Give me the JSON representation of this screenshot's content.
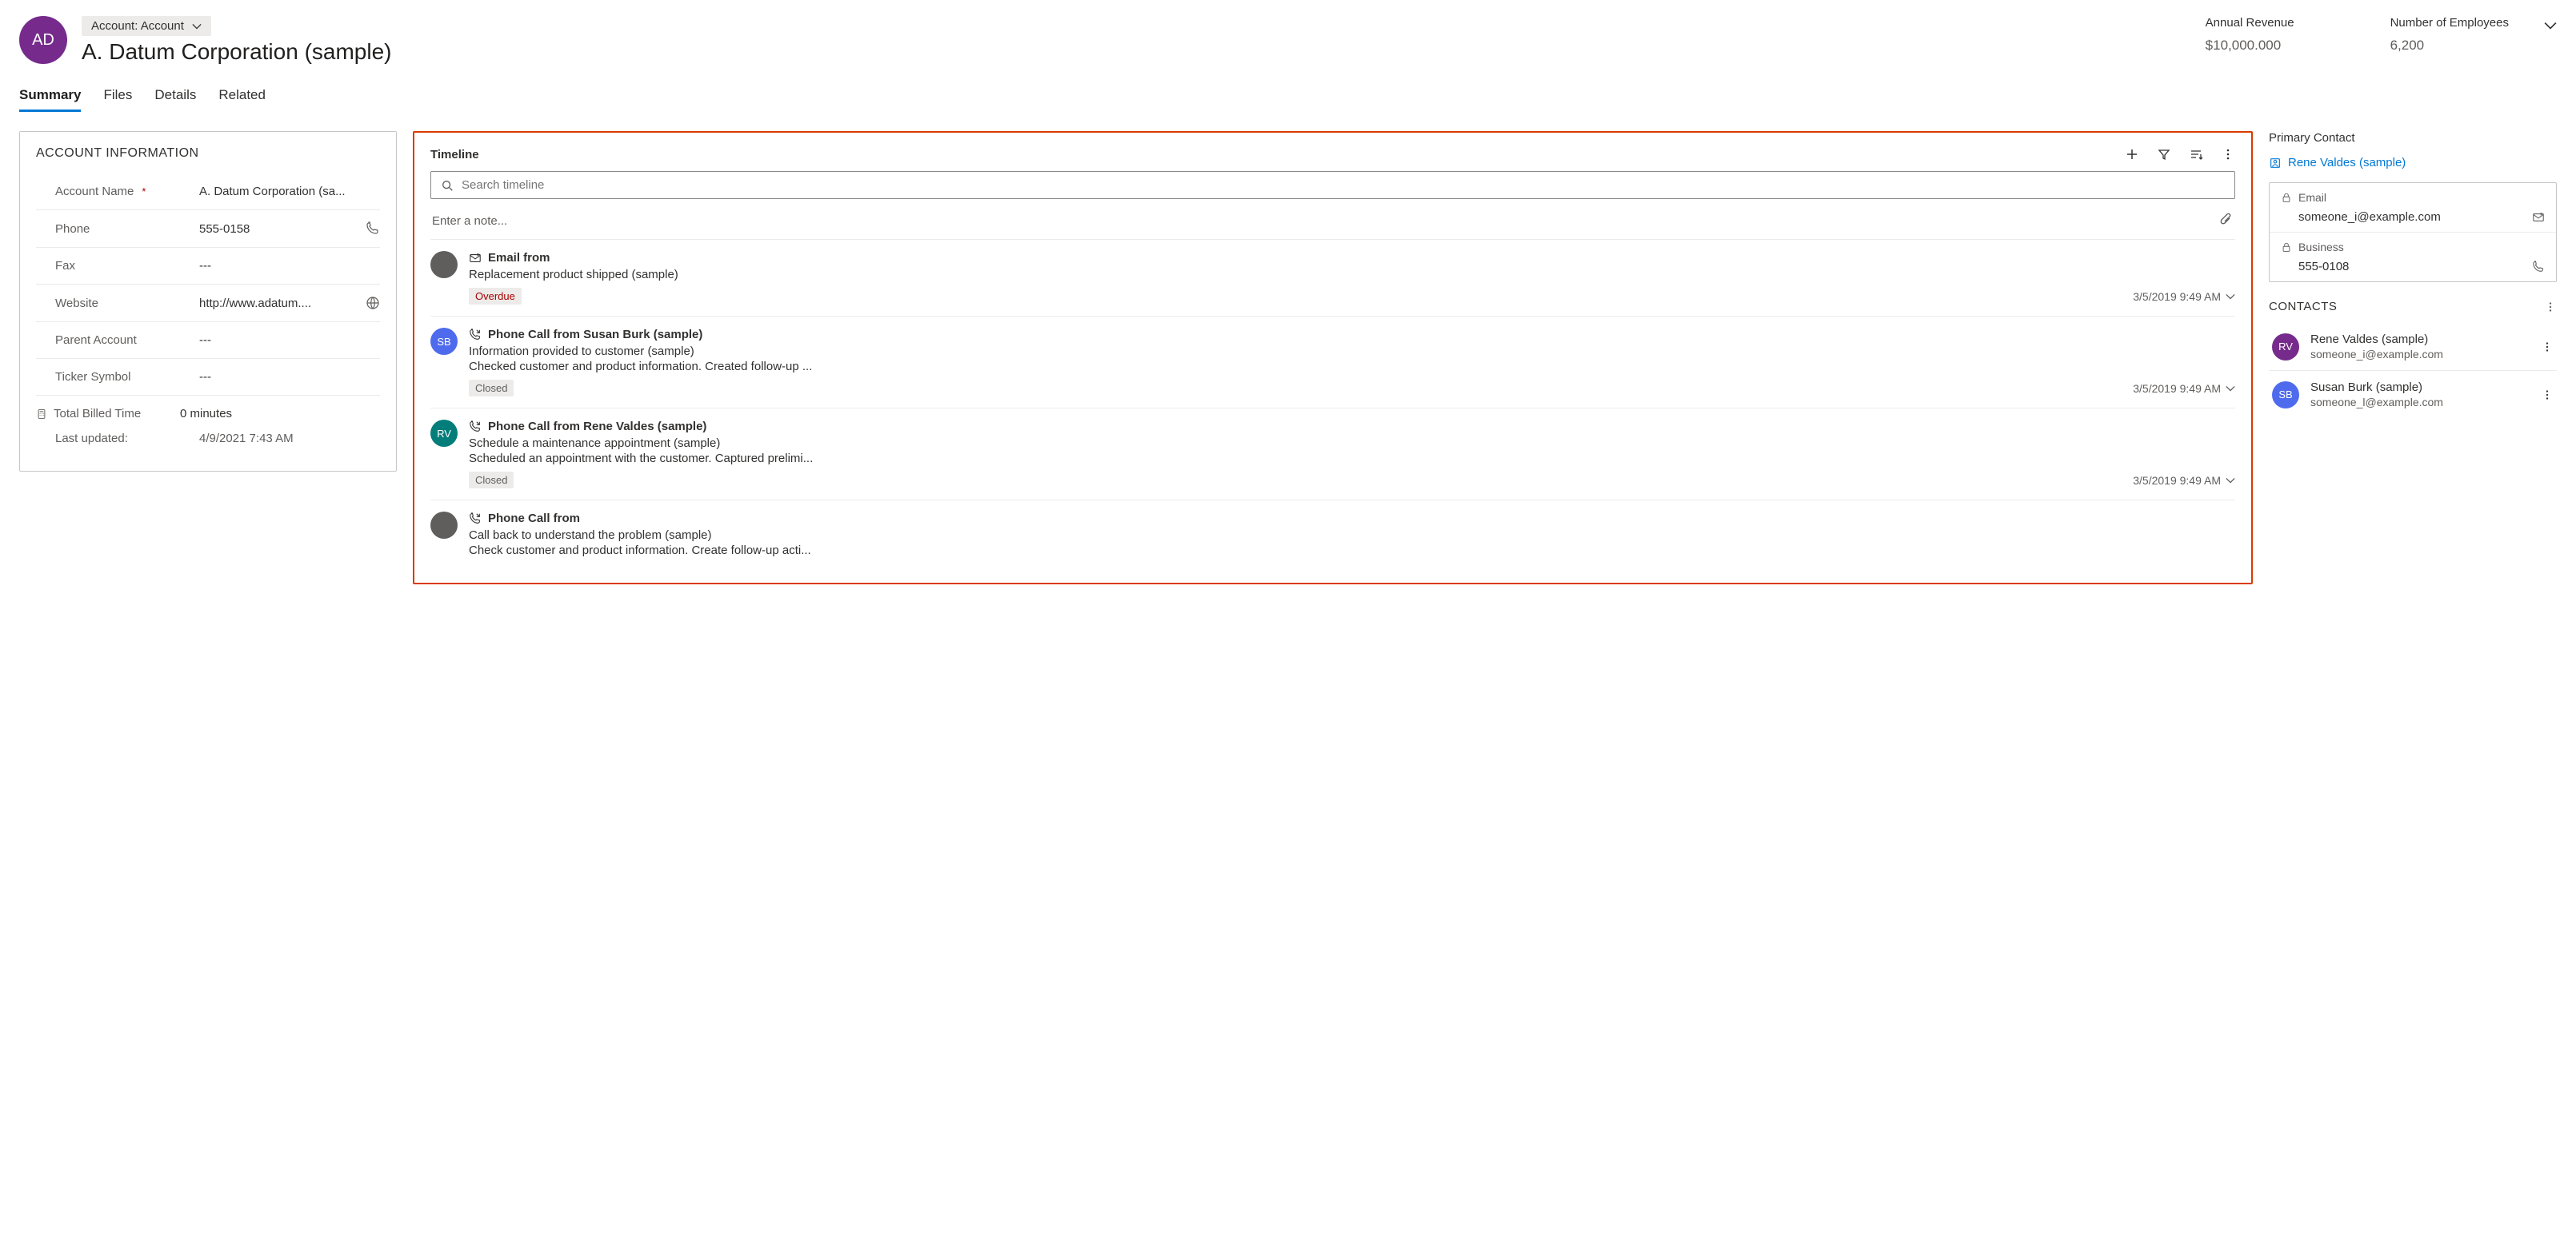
{
  "header": {
    "avatar_initials": "AD",
    "entity_selector": "Account: Account",
    "record_title": "A. Datum Corporation (sample)",
    "metrics": {
      "revenue_label": "Annual Revenue",
      "revenue_value": "$10,000.000",
      "employees_label": "Number of Employees",
      "employees_value": "6,200"
    }
  },
  "tabs": {
    "summary": "Summary",
    "files": "Files",
    "details": "Details",
    "related": "Related"
  },
  "account_info": {
    "section_title": "ACCOUNT INFORMATION",
    "account_name_label": "Account Name",
    "account_name_value": "A. Datum Corporation (sa...",
    "phone_label": "Phone",
    "phone_value": "555-0158",
    "fax_label": "Fax",
    "fax_value": "---",
    "website_label": "Website",
    "website_value": "http://www.adatum....",
    "parent_label": "Parent Account",
    "parent_value": "---",
    "ticker_label": "Ticker Symbol",
    "ticker_value": "---",
    "billed_label": "Total Billed Time",
    "billed_value": "0 minutes",
    "last_updated_label": "Last updated:",
    "last_updated_value": "4/9/2021 7:43 AM"
  },
  "timeline": {
    "title": "Timeline",
    "search_placeholder": "Search timeline",
    "note_placeholder": "Enter a note...",
    "items": [
      {
        "avatar_bg": "#605e5c",
        "avatar_text": "",
        "type_icon": "email",
        "type_label": "Email from",
        "subject": "Replacement product shipped (sample)",
        "description": "",
        "badge": "Overdue",
        "badge_style": "overdue",
        "date": "3/5/2019 9:49 AM"
      },
      {
        "avatar_bg": "#4f6bed",
        "avatar_text": "SB",
        "type_icon": "phone",
        "type_label": "Phone Call from Susan Burk (sample)",
        "subject": "Information provided to customer (sample)",
        "description": "Checked customer and product information. Created follow-up ...",
        "badge": "Closed",
        "badge_style": "",
        "date": "3/5/2019 9:49 AM"
      },
      {
        "avatar_bg": "#037d7a",
        "avatar_text": "RV",
        "type_icon": "phone",
        "type_label": "Phone Call from Rene Valdes (sample)",
        "subject": "Schedule a maintenance appointment (sample)",
        "description": "Scheduled an appointment with the customer. Captured prelimi...",
        "badge": "Closed",
        "badge_style": "",
        "date": "3/5/2019 9:49 AM"
      },
      {
        "avatar_bg": "#605e5c",
        "avatar_text": "",
        "type_icon": "phone",
        "type_label": "Phone Call from",
        "subject": "Call back to understand the problem (sample)",
        "description": "Check customer and product information. Create follow-up acti...",
        "badge": "",
        "badge_style": "",
        "date": ""
      }
    ]
  },
  "primary_contact": {
    "label": "Primary Contact",
    "name": "Rene Valdes (sample)",
    "email_label": "Email",
    "email_value": "someone_i@example.com",
    "business_label": "Business",
    "business_value": "555-0108"
  },
  "contacts": {
    "title": "CONTACTS",
    "items": [
      {
        "avatar_bg": "#762b8c",
        "avatar_text": "RV",
        "name": "Rene Valdes (sample)",
        "email": "someone_i@example.com"
      },
      {
        "avatar_bg": "#4f6bed",
        "avatar_text": "SB",
        "name": "Susan Burk (sample)",
        "email": "someone_l@example.com"
      }
    ]
  }
}
